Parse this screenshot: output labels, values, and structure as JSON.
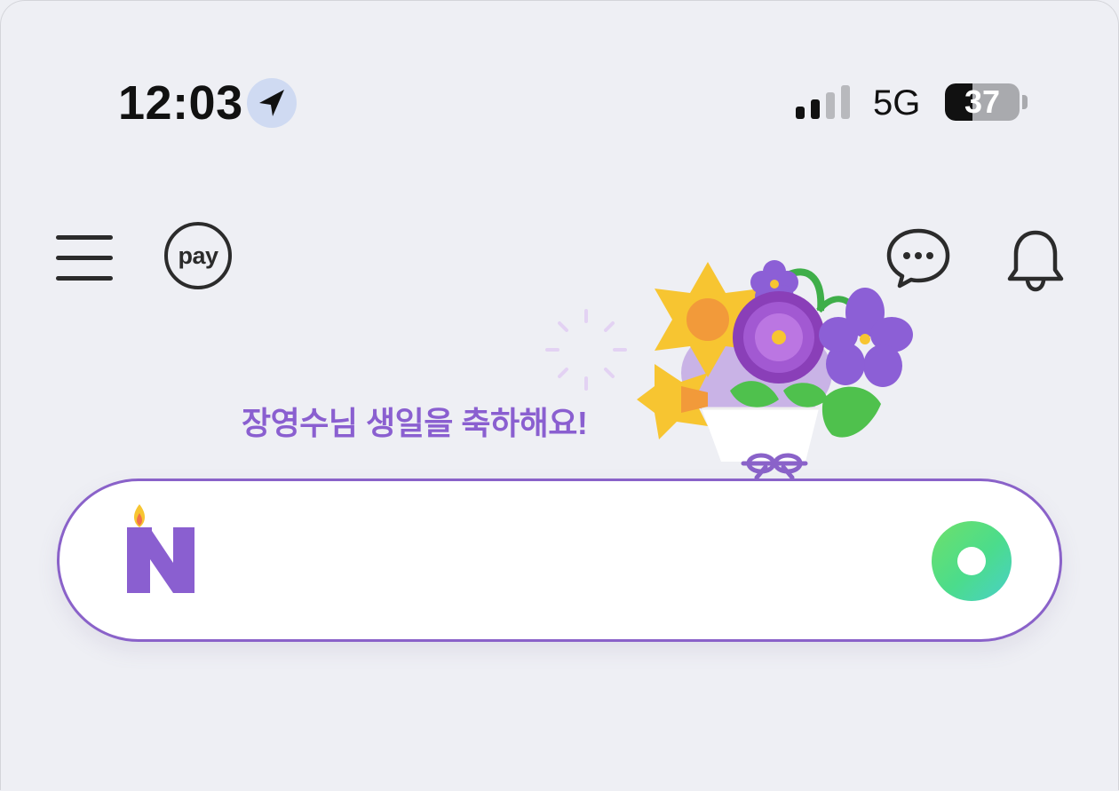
{
  "status_bar": {
    "time": "12:03",
    "network": "5G",
    "battery_level": "37",
    "battery_fraction": 0.37,
    "location_icon": "location-arrow-icon",
    "signal_bars_active": 2,
    "signal_bars_total": 4
  },
  "toolbar": {
    "menu_icon": "hamburger-menu-icon",
    "pay_label": "pay",
    "chat_icon": "chat-bubble-icon",
    "bell_icon": "bell-icon"
  },
  "greeting": {
    "text": "장영수님 생일을 축하해요!",
    "color": "#8a5fd0"
  },
  "search": {
    "value": "",
    "placeholder": "",
    "border_color": "#8a62c9",
    "logo_letter": "N",
    "logo_color": "#8a5fd0"
  }
}
